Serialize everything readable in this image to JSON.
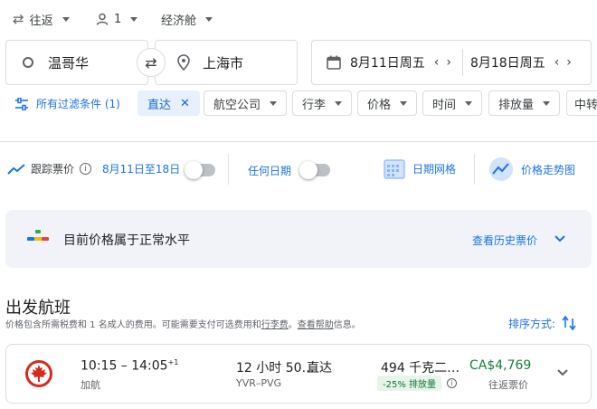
{
  "top": {
    "trip_type": "往返",
    "passengers": "1",
    "cabin": "经济舱"
  },
  "search": {
    "origin": "温哥华",
    "destination": "上海市",
    "depart_date": "8月11日周五",
    "return_date": "8月18日周五"
  },
  "filters": {
    "all_filters": "所有过滤条件 (1)",
    "chips": [
      "直达",
      "航空公司",
      "行李",
      "价格",
      "时间",
      "排放量",
      "中转"
    ]
  },
  "tools": {
    "track_label": "跟踪票价",
    "track_dates": "8月11日至18日",
    "any_dates": "任何日期",
    "date_grid": "日期网格",
    "price_graph": "价格走势图"
  },
  "insight": {
    "text": "目前价格属于正常水平",
    "link": "查看历史票价"
  },
  "results": {
    "heading": "出发航班",
    "note_prefix": "价格包含所需税费和 1 名成人的费用。可能需要支付可选费用和",
    "note_link1": "行李费",
    "note_mid": "。",
    "note_link2": "查看帮助",
    "note_suffix": "信息。",
    "sort_label": "排序方式:"
  },
  "flight": {
    "times": "10:15 – 14:05",
    "day_offset": "+1",
    "airline": "加航",
    "duration": "12 小时 50…",
    "route": "YVR–PVG",
    "stops": "直达",
    "emissions": "494 千克二…",
    "emissions_badge": "-25% 排放量",
    "price": "CA$4,769",
    "price_type": "往返票价"
  },
  "colors": {
    "accent": "#1a73e8",
    "price_green": "#188038",
    "airline_red": "#d52b1e"
  }
}
